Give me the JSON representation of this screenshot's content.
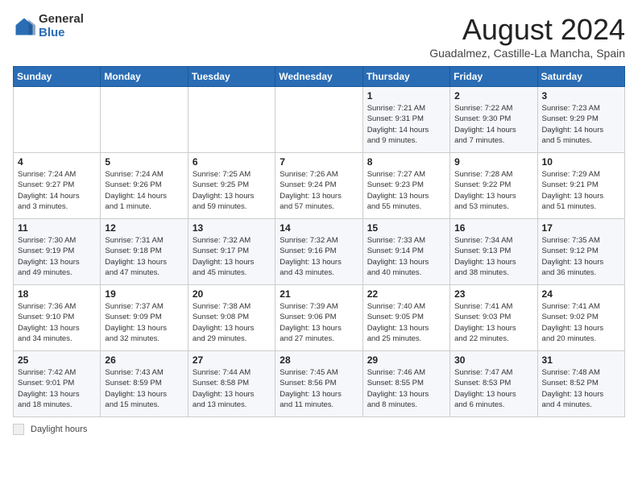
{
  "header": {
    "logo_general": "General",
    "logo_blue": "Blue",
    "month_title": "August 2024",
    "location": "Guadalmez, Castille-La Mancha, Spain"
  },
  "days_of_week": [
    "Sunday",
    "Monday",
    "Tuesday",
    "Wednesday",
    "Thursday",
    "Friday",
    "Saturday"
  ],
  "weeks": [
    [
      {
        "day": "",
        "info": ""
      },
      {
        "day": "",
        "info": ""
      },
      {
        "day": "",
        "info": ""
      },
      {
        "day": "",
        "info": ""
      },
      {
        "day": "1",
        "info": "Sunrise: 7:21 AM\nSunset: 9:31 PM\nDaylight: 14 hours\nand 9 minutes."
      },
      {
        "day": "2",
        "info": "Sunrise: 7:22 AM\nSunset: 9:30 PM\nDaylight: 14 hours\nand 7 minutes."
      },
      {
        "day": "3",
        "info": "Sunrise: 7:23 AM\nSunset: 9:29 PM\nDaylight: 14 hours\nand 5 minutes."
      }
    ],
    [
      {
        "day": "4",
        "info": "Sunrise: 7:24 AM\nSunset: 9:27 PM\nDaylight: 14 hours\nand 3 minutes."
      },
      {
        "day": "5",
        "info": "Sunrise: 7:24 AM\nSunset: 9:26 PM\nDaylight: 14 hours\nand 1 minute."
      },
      {
        "day": "6",
        "info": "Sunrise: 7:25 AM\nSunset: 9:25 PM\nDaylight: 13 hours\nand 59 minutes."
      },
      {
        "day": "7",
        "info": "Sunrise: 7:26 AM\nSunset: 9:24 PM\nDaylight: 13 hours\nand 57 minutes."
      },
      {
        "day": "8",
        "info": "Sunrise: 7:27 AM\nSunset: 9:23 PM\nDaylight: 13 hours\nand 55 minutes."
      },
      {
        "day": "9",
        "info": "Sunrise: 7:28 AM\nSunset: 9:22 PM\nDaylight: 13 hours\nand 53 minutes."
      },
      {
        "day": "10",
        "info": "Sunrise: 7:29 AM\nSunset: 9:21 PM\nDaylight: 13 hours\nand 51 minutes."
      }
    ],
    [
      {
        "day": "11",
        "info": "Sunrise: 7:30 AM\nSunset: 9:19 PM\nDaylight: 13 hours\nand 49 minutes."
      },
      {
        "day": "12",
        "info": "Sunrise: 7:31 AM\nSunset: 9:18 PM\nDaylight: 13 hours\nand 47 minutes."
      },
      {
        "day": "13",
        "info": "Sunrise: 7:32 AM\nSunset: 9:17 PM\nDaylight: 13 hours\nand 45 minutes."
      },
      {
        "day": "14",
        "info": "Sunrise: 7:32 AM\nSunset: 9:16 PM\nDaylight: 13 hours\nand 43 minutes."
      },
      {
        "day": "15",
        "info": "Sunrise: 7:33 AM\nSunset: 9:14 PM\nDaylight: 13 hours\nand 40 minutes."
      },
      {
        "day": "16",
        "info": "Sunrise: 7:34 AM\nSunset: 9:13 PM\nDaylight: 13 hours\nand 38 minutes."
      },
      {
        "day": "17",
        "info": "Sunrise: 7:35 AM\nSunset: 9:12 PM\nDaylight: 13 hours\nand 36 minutes."
      }
    ],
    [
      {
        "day": "18",
        "info": "Sunrise: 7:36 AM\nSunset: 9:10 PM\nDaylight: 13 hours\nand 34 minutes."
      },
      {
        "day": "19",
        "info": "Sunrise: 7:37 AM\nSunset: 9:09 PM\nDaylight: 13 hours\nand 32 minutes."
      },
      {
        "day": "20",
        "info": "Sunrise: 7:38 AM\nSunset: 9:08 PM\nDaylight: 13 hours\nand 29 minutes."
      },
      {
        "day": "21",
        "info": "Sunrise: 7:39 AM\nSunset: 9:06 PM\nDaylight: 13 hours\nand 27 minutes."
      },
      {
        "day": "22",
        "info": "Sunrise: 7:40 AM\nSunset: 9:05 PM\nDaylight: 13 hours\nand 25 minutes."
      },
      {
        "day": "23",
        "info": "Sunrise: 7:41 AM\nSunset: 9:03 PM\nDaylight: 13 hours\nand 22 minutes."
      },
      {
        "day": "24",
        "info": "Sunrise: 7:41 AM\nSunset: 9:02 PM\nDaylight: 13 hours\nand 20 minutes."
      }
    ],
    [
      {
        "day": "25",
        "info": "Sunrise: 7:42 AM\nSunset: 9:01 PM\nDaylight: 13 hours\nand 18 minutes."
      },
      {
        "day": "26",
        "info": "Sunrise: 7:43 AM\nSunset: 8:59 PM\nDaylight: 13 hours\nand 15 minutes."
      },
      {
        "day": "27",
        "info": "Sunrise: 7:44 AM\nSunset: 8:58 PM\nDaylight: 13 hours\nand 13 minutes."
      },
      {
        "day": "28",
        "info": "Sunrise: 7:45 AM\nSunset: 8:56 PM\nDaylight: 13 hours\nand 11 minutes."
      },
      {
        "day": "29",
        "info": "Sunrise: 7:46 AM\nSunset: 8:55 PM\nDaylight: 13 hours\nand 8 minutes."
      },
      {
        "day": "30",
        "info": "Sunrise: 7:47 AM\nSunset: 8:53 PM\nDaylight: 13 hours\nand 6 minutes."
      },
      {
        "day": "31",
        "info": "Sunrise: 7:48 AM\nSunset: 8:52 PM\nDaylight: 13 hours\nand 4 minutes."
      }
    ]
  ],
  "legend": {
    "label": "Daylight hours"
  }
}
